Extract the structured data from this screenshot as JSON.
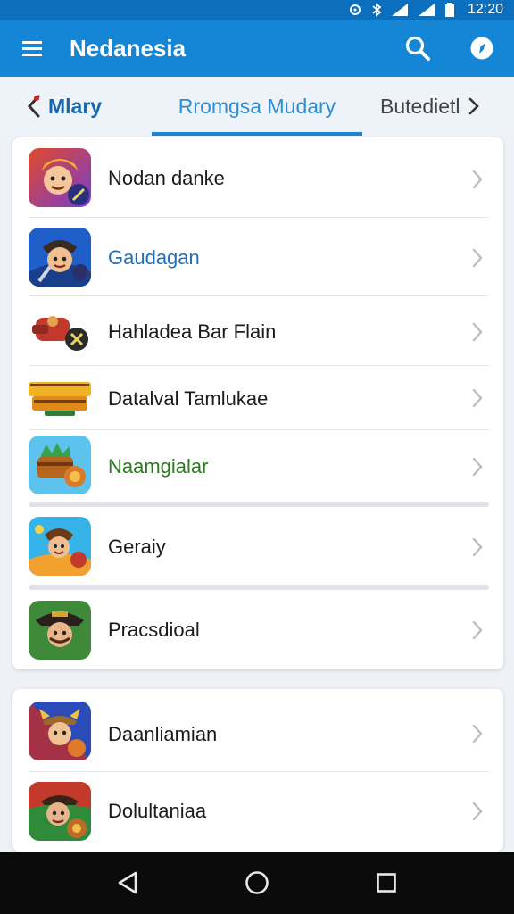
{
  "status_bar": {
    "time": "12:20",
    "icons": [
      "alarm-icon",
      "bluetooth-icon",
      "wifi-icon",
      "signal-icon",
      "battery-icon"
    ]
  },
  "app_bar": {
    "title": "Nedanesia",
    "menu_icon": "menu-icon",
    "actions": [
      "search-icon",
      "compass-icon"
    ],
    "colors": {
      "bar": "#1586d6",
      "status": "#0c6fbd"
    }
  },
  "tabs": {
    "left": "Mlary",
    "center": "Rromgsa Mudary",
    "right": "Butedietl",
    "active_color": "#1a86d4"
  },
  "list": {
    "group1": [
      {
        "label": "Nodan danke",
        "color": "#1b1b1b",
        "icon": "warrior-game-icon"
      },
      {
        "label": "Gaudagan",
        "color": "#1e6fb8",
        "icon": "hero-game-icon"
      },
      {
        "label": "Hahladea Bar Flain",
        "color": "#1b1b1b",
        "icon": "cannon-game-icon"
      },
      {
        "label": "Datalval Tamlukae",
        "color": "#1b1b1b",
        "icon": "logo-game-icon"
      },
      {
        "label": "Naamgialar",
        "color": "#2a7a1f",
        "icon": "treasure-game-icon"
      },
      {
        "label": "Geraiy",
        "color": "#1b1b1b",
        "icon": "adventure-game-icon"
      },
      {
        "label": "Pracsdioal",
        "color": "#1b1b1b",
        "icon": "pirate-game-icon"
      }
    ],
    "group2": [
      {
        "label": "Daanliamian",
        "color": "#1b1b1b",
        "icon": "viking-game-icon"
      },
      {
        "label": "Dolultaniaa",
        "color": "#1b1b1b",
        "icon": "bandit-game-icon"
      }
    ]
  },
  "nav_bar": {
    "buttons": [
      "back-icon",
      "home-icon",
      "recents-icon"
    ]
  }
}
